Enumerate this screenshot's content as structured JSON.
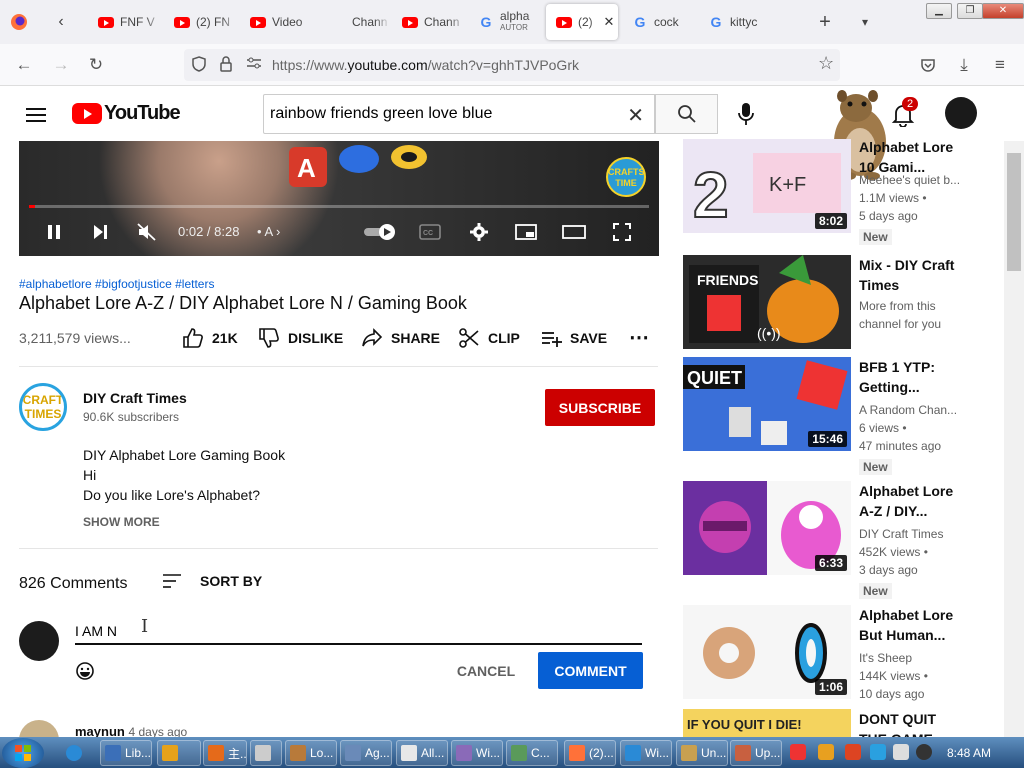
{
  "browser": {
    "tabs": [
      {
        "icon": "youtube",
        "title": "FNF V"
      },
      {
        "icon": "youtube",
        "title": "(2) FN"
      },
      {
        "icon": "youtube",
        "title": "Video"
      },
      {
        "icon": "none",
        "title": "Chann"
      },
      {
        "icon": "youtube",
        "title": "Chann"
      },
      {
        "icon": "google",
        "title": "alpha",
        "subtitle": "AUTOR"
      },
      {
        "icon": "youtube",
        "title": "(2)",
        "active": true
      },
      {
        "icon": "google",
        "title": "cock"
      },
      {
        "icon": "google",
        "title": "kittyc"
      }
    ],
    "url_prefix": "https://www.",
    "url_domain": "youtube.com",
    "url_path": "/watch?v=ghhTJVPoGrk"
  },
  "youtube": {
    "logo_text": "YouTube",
    "search_value": "rainbow friends green love blue",
    "notif_count": "2"
  },
  "player": {
    "time": "0:02 / 8:28",
    "chapter": "A",
    "watermark": "CRAFTS TIME"
  },
  "video": {
    "hashtags": "#alphabetlore #bigfootjustice #letters",
    "title": "Alphabet Lore A-Z / DIY Alphabet Lore N / Gaming Book",
    "views": "3,211,579 views...",
    "likes": "21K",
    "dislike": "DISLIKE",
    "share": "SHARE",
    "clip": "CLIP",
    "save": "SAVE"
  },
  "channel": {
    "avatar_text": "CRAFT TIMES",
    "name": "DIY Craft Times",
    "subs": "90.6K subscribers",
    "subscribe": "SUBSCRIBE",
    "desc1": "DIY Alphabet Lore Gaming Book",
    "desc2": "Hi",
    "desc3": "Do you like Lore's Alphabet?",
    "show_more": "SHOW MORE"
  },
  "comments": {
    "count": "826 Comments",
    "sort": "SORT BY",
    "input_value": "I AM N",
    "cancel": "CANCEL",
    "submit": "COMMENT",
    "first_author": "maynun",
    "first_time": "4 days ago"
  },
  "recs": [
    {
      "title": "Alphabet Lore 10 Gami...",
      "channel": "Meehee's quiet b...",
      "views": "1.1M views •",
      "age": "5 days ago",
      "badge": "New",
      "duration": "8:02",
      "color": "#e8e4f0"
    },
    {
      "title": "Mix - DIY Craft Times",
      "channel": "More from this channel for you",
      "views": "",
      "age": "",
      "badge": "",
      "duration": "",
      "color": "#2b2b2b"
    },
    {
      "title": "BFB 1 YTP: Getting...",
      "channel": "A Random Chan...",
      "views": "6 views •",
      "age": "47 minutes ago",
      "badge": "New",
      "duration": "15:46",
      "color": "#3a6fd8"
    },
    {
      "title": "Alphabet Lore A-Z / DIY...",
      "channel": "DIY Craft Times",
      "views": "452K views •",
      "age": "3 days ago",
      "badge": "New",
      "duration": "6:33",
      "color": "#c43fb0"
    },
    {
      "title": "Alphabet Lore But Human...",
      "channel": "It's Sheep",
      "views": "144K views •",
      "age": "10 days ago",
      "badge": "",
      "duration": "1:06",
      "color": "#f6f6f6"
    },
    {
      "title": "DONT QUIT THE GAME",
      "channel": "",
      "views": "",
      "age": "",
      "badge": "",
      "duration": "",
      "color": "#f4d35e"
    }
  ],
  "rec6_thumb_text": "IF YOU QUIT I DIE!",
  "taskbar": {
    "items": [
      "Lib...",
      "",
      "主...",
      "",
      "Lo...",
      "Ag...",
      "All...",
      "Wi...",
      "C...",
      "(2)...",
      "Wi...",
      "Un...",
      "Up..."
    ],
    "clock": "8:48 AM"
  }
}
